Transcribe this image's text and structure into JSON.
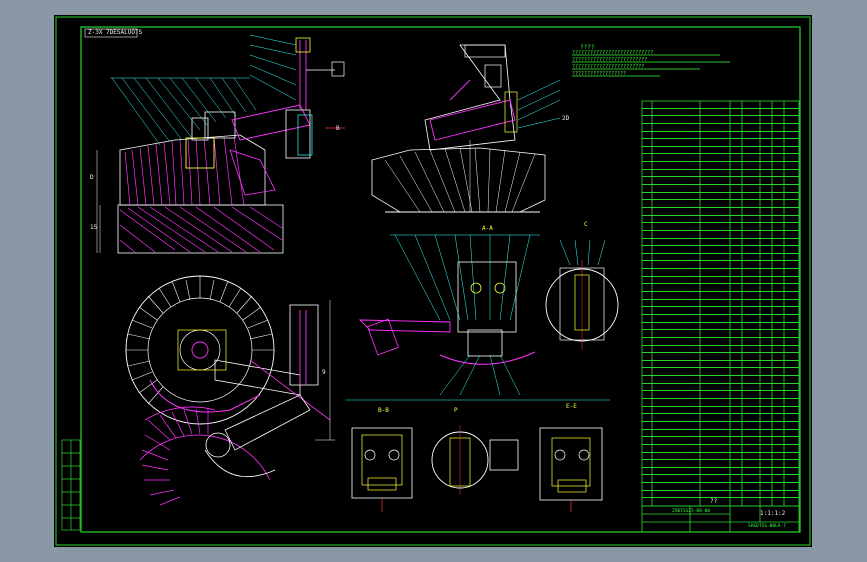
{
  "drawing": {
    "title_box": "Z-3X 7DESALUOTS",
    "notes_title": "????",
    "notes": [
      "???????????????????????????",
      "?????????????????????????",
      "????????????????????????",
      "??????????????????"
    ],
    "views": {
      "section_aa": "A-A",
      "section_bb": "B-B",
      "section_cc": "C-C",
      "section_ee": "E-E",
      "view_c": "C",
      "view_d": "P"
    },
    "dimension_labels": {
      "b1": "B",
      "b2": "D",
      "b3": "15",
      "b4": "9",
      "b5": "2D"
    },
    "title_block": {
      "drawing_no": "ZXBTSS25-00-00",
      "name": "??",
      "scale": "1:1:1:2",
      "org": "SHSDTSS-00LA-7"
    },
    "parts_rows": 53,
    "colors": {
      "border": "#2bd62b",
      "line": "#ffffff",
      "magenta": "#ff33ff",
      "cyan": "#33ffff",
      "yellow": "#ffff33",
      "red": "#ff3333",
      "background": "#000000"
    }
  }
}
